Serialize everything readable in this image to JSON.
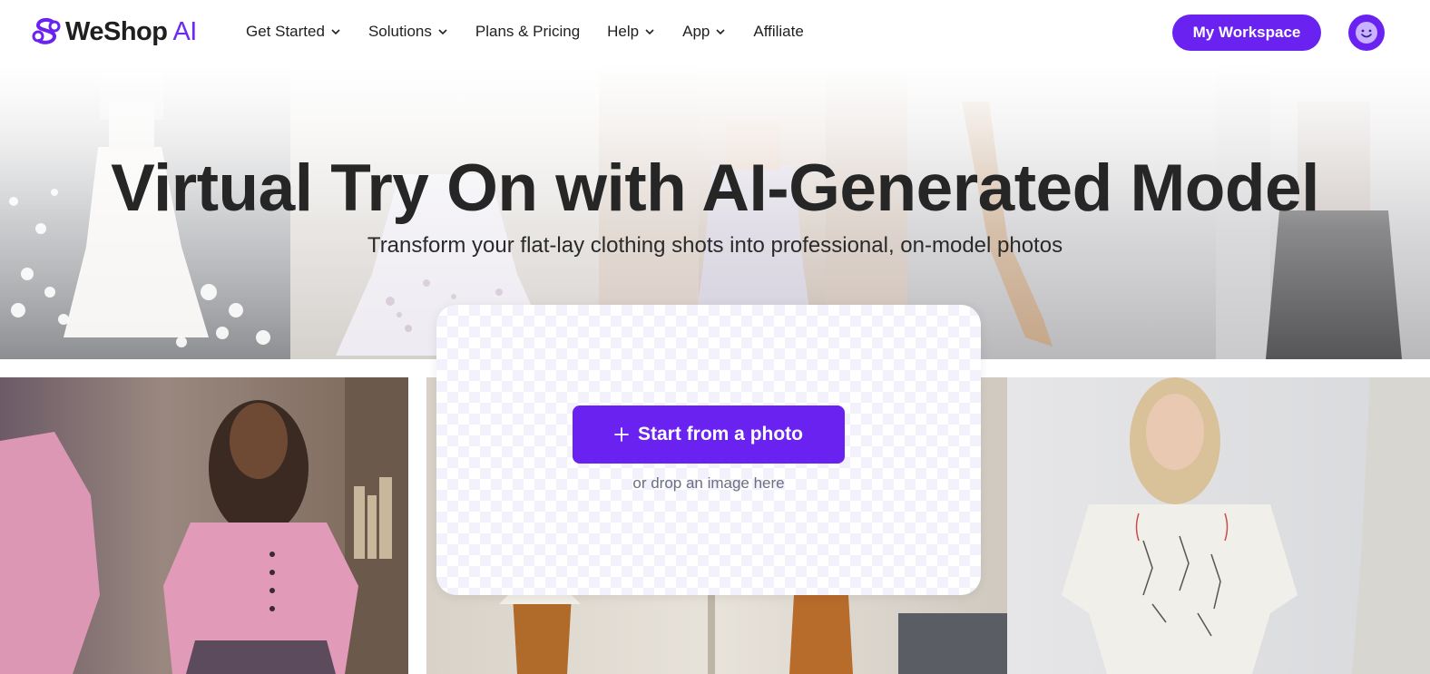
{
  "brand": {
    "name": "WeShop",
    "suffix": "AI",
    "accent_color": "#6a22f0"
  },
  "nav": {
    "items": [
      {
        "label": "Get Started",
        "has_dropdown": true
      },
      {
        "label": "Solutions",
        "has_dropdown": true
      },
      {
        "label": "Plans & Pricing",
        "has_dropdown": false
      },
      {
        "label": "Help",
        "has_dropdown": true
      },
      {
        "label": "App",
        "has_dropdown": true
      },
      {
        "label": "Affiliate",
        "has_dropdown": false
      }
    ]
  },
  "header": {
    "workspace_label": "My Workspace",
    "avatar_icon": "smiley-face-icon"
  },
  "hero": {
    "title": "Virtual Try On with AI-Generated Model",
    "subtitle": "Transform your flat-lay clothing shots into professional, on-model photos"
  },
  "upload": {
    "button_label": "Start from a photo",
    "button_icon": "plus-icon",
    "hint": "or drop an image here"
  }
}
